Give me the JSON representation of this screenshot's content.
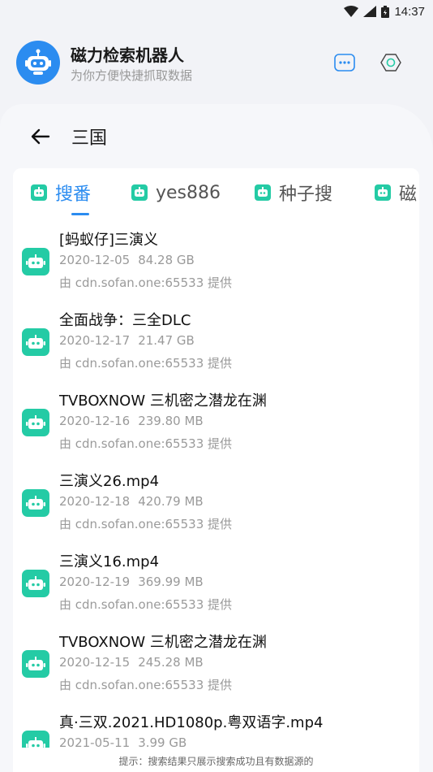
{
  "status_bar": {
    "time": "14:37"
  },
  "app": {
    "title": "磁力检索机器人",
    "subtitle": "为你方便快捷抓取数据"
  },
  "search": {
    "query": "三国"
  },
  "tabs": [
    {
      "label": "搜番",
      "active": true
    },
    {
      "label": "yes886",
      "active": false
    },
    {
      "label": "种子搜",
      "active": false
    },
    {
      "label": "磁",
      "active": false
    }
  ],
  "results": [
    {
      "title": "[蚂蚁仔]三演义",
      "date": "2020-12-05",
      "size": "84.28 GB",
      "source": "由 cdn.sofan.one:65533 提供"
    },
    {
      "title": "全面战争：三全DLC",
      "date": "2020-12-17",
      "size": "21.47 GB",
      "source": "由 cdn.sofan.one:65533 提供"
    },
    {
      "title": "TVBOXNOW 三机密之潜龙在渊",
      "date": "2020-12-16",
      "size": "239.80 MB",
      "source": "由 cdn.sofan.one:65533 提供"
    },
    {
      "title": "三演义26.mp4",
      "date": "2020-12-18",
      "size": "420.79 MB",
      "source": "由 cdn.sofan.one:65533 提供"
    },
    {
      "title": "三演义16.mp4",
      "date": "2020-12-19",
      "size": "369.99 MB",
      "source": "由 cdn.sofan.one:65533 提供"
    },
    {
      "title": "TVBOXNOW 三机密之潜龙在渊",
      "date": "2020-12-15",
      "size": "245.28 MB",
      "source": "由 cdn.sofan.one:65533 提供"
    },
    {
      "title": "真·三双.2021.HD1080p.粤双语字.mp4",
      "date": "2021-05-11",
      "size": "3.99 GB",
      "source": ""
    }
  ],
  "footer": {
    "tip": "提示：搜索结果只展示搜索成功且有数据源的"
  },
  "colors": {
    "accent": "#2b8cf0",
    "result_icon": "#24cba5"
  }
}
